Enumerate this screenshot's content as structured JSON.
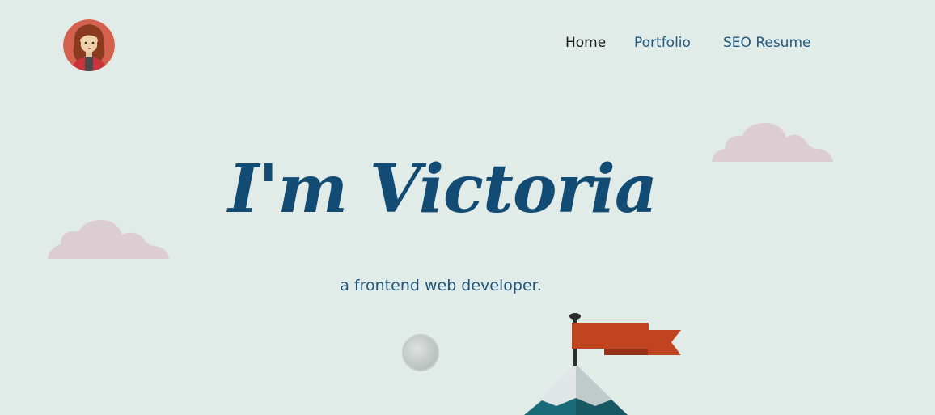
{
  "nav": {
    "items": [
      {
        "label": "Home",
        "active": true
      },
      {
        "label": "Portfolio",
        "active": false
      },
      {
        "label": "SEO Resume",
        "active": false
      }
    ]
  },
  "hero": {
    "title": "I'm Victoria",
    "subtitle": "a frontend web developer."
  },
  "colors": {
    "background": "#e1ebe8",
    "title": "#124b73",
    "link": "#215a7e",
    "cloud": "#dccdd2",
    "flag": "#c14420"
  },
  "icons": {
    "avatar": "woman-avatar-icon",
    "moon": "moon-icon",
    "flag": "flag-icon",
    "mountain": "mountain-icon",
    "cloud": "cloud-icon"
  }
}
